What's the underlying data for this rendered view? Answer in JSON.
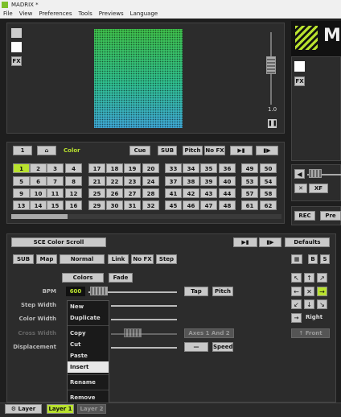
{
  "window": {
    "title": "MADRIX *"
  },
  "menu": [
    "File",
    "View",
    "Preferences",
    "Tools",
    "Previews",
    "Language"
  ],
  "preview": {
    "fx": "FX",
    "level": "1.0"
  },
  "right": {
    "fx": "FX",
    "xf": "XF",
    "rec": "REC",
    "pre": "Pre"
  },
  "storage": {
    "num": "1",
    "label": "Color",
    "cue": "Cue",
    "sub": "SUB",
    "pitch": "Pitch",
    "nofx": "No FX",
    "places": [
      "1",
      "2",
      "3",
      "4",
      "5",
      "6",
      "7",
      "8",
      "9",
      "10",
      "11",
      "12",
      "13",
      "14",
      "15",
      "16",
      "17",
      "18",
      "19",
      "20",
      "21",
      "22",
      "23",
      "24",
      "25",
      "26",
      "27",
      "28",
      "29",
      "30",
      "31",
      "32",
      "33",
      "34",
      "35",
      "36",
      "37",
      "38",
      "39",
      "40",
      "41",
      "42",
      "43",
      "44",
      "45",
      "46",
      "47",
      "48",
      "49",
      "50",
      "53",
      "54",
      "57",
      "58",
      "61",
      "62"
    ]
  },
  "effect": {
    "name": "SCE Color Scroll",
    "defaults": "Defaults",
    "sub": "SUB",
    "map": "Map",
    "mode": "Normal",
    "link": "Link",
    "nofx": "No FX",
    "step": "Step",
    "b": "B",
    "s": "S"
  },
  "params": {
    "colors": "Colors",
    "fade": "Fade",
    "bpm_label": "BPM",
    "bpm_value": "600",
    "tap": "Tap",
    "pitch": "Pitch",
    "step_width": "Step Width",
    "color_width": "Color Width",
    "cross_width": "Cross Width",
    "displacement": "Displacement",
    "axes": "Axes 1 And 2",
    "speed": "Speed",
    "right": "Right",
    "front": "Front"
  },
  "context_menu": {
    "new": "New",
    "duplicate": "Duplicate",
    "copy": "Copy",
    "cut": "Cut",
    "paste": "Paste",
    "insert": "Insert",
    "rename": "Rename",
    "remove": "Remove"
  },
  "layers": {
    "layer_btn": "Layer",
    "layer1": "Layer 1",
    "layer2": "Layer 2"
  }
}
